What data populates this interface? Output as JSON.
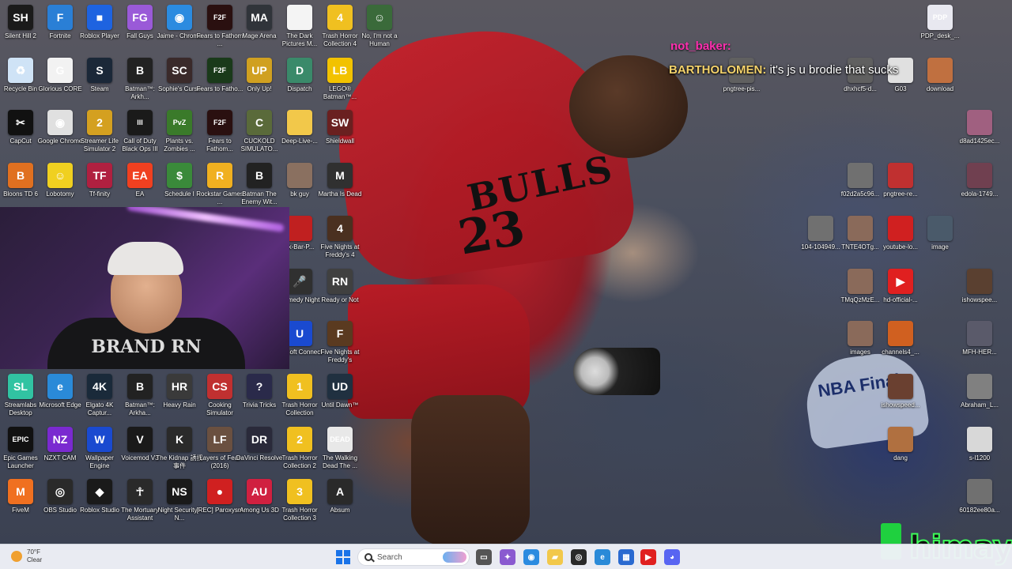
{
  "desktop": {
    "icons": [
      {
        "name": "silent-hill-2",
        "label": "Silent Hill 2",
        "icon": "silent-hill-icon",
        "color": "#1b1b1b",
        "glyph": "SH"
      },
      {
        "name": "fortnite",
        "label": "Fortnite",
        "icon": "fortnite-icon",
        "color": "#2a7fd6",
        "glyph": "F"
      },
      {
        "name": "roblox-player",
        "label": "Roblox Player",
        "icon": "roblox-icon",
        "color": "#1e63e0",
        "glyph": "■"
      },
      {
        "name": "fall-guys",
        "label": "Fall Guys",
        "icon": "fall-guys-icon",
        "color": "#9a5ad8",
        "glyph": "FG"
      },
      {
        "name": "jaime-chrome",
        "label": "Jaime - Chrome",
        "icon": "chrome-icon",
        "color": "#2b8be0",
        "glyph": "◉"
      },
      {
        "name": "fears-to-fathom-1",
        "label": "Fears to Fathom ...",
        "icon": "fears-to-fathom-icon",
        "color": "#2a1010",
        "glyph": "F2F"
      },
      {
        "name": "mage-arena",
        "label": "Mage Arena",
        "icon": "mage-arena-icon",
        "color": "#30343a",
        "glyph": "MA"
      },
      {
        "name": "dark-pictures",
        "label": "The Dark Pictures M...",
        "icon": "document-icon",
        "color": "#f4f4f4",
        "glyph": ""
      },
      {
        "name": "trash-horror-4",
        "label": "Trash Horror Collection 4",
        "icon": "trash-horror-icon",
        "color": "#f0c020",
        "glyph": "4"
      },
      {
        "name": "not-a-human",
        "label": "No, I'm not a Human",
        "icon": "not-a-human-icon",
        "color": "#3a6a3a",
        "glyph": "☺"
      },
      {
        "name": "recycle-bin",
        "label": "Recycle Bin",
        "icon": "recycle-bin-icon",
        "color": "#cfe3f6",
        "glyph": "♻"
      },
      {
        "name": "glorious-core",
        "label": "Glorious CORE",
        "icon": "glorious-core-icon",
        "color": "#f2f2f2",
        "glyph": "G"
      },
      {
        "name": "steam",
        "label": "Steam",
        "icon": "steam-icon",
        "color": "#1b2838",
        "glyph": "S"
      },
      {
        "name": "batman-arkham-1",
        "label": "Batman™: Arkh...",
        "icon": "batman-icon",
        "color": "#222",
        "glyph": "B"
      },
      {
        "name": "sophies-curse",
        "label": "Sophie's Curse",
        "icon": "sophies-curse-icon",
        "color": "#3a2a2a",
        "glyph": "SC"
      },
      {
        "name": "fears-to-fathom-2",
        "label": "Fears to Fatho...",
        "icon": "fears-to-fathom-icon",
        "color": "#1a3a1a",
        "glyph": "F2F"
      },
      {
        "name": "only-up",
        "label": "Only Up!",
        "icon": "only-up-icon",
        "color": "#d0a020",
        "glyph": "UP"
      },
      {
        "name": "dispatch",
        "label": "Dispatch",
        "icon": "dispatch-icon",
        "color": "#3a8a6a",
        "glyph": "D"
      },
      {
        "name": "lego-batman",
        "label": "LEGO® Batman™...",
        "icon": "lego-batman-icon",
        "color": "#f2c200",
        "glyph": "LB"
      },
      {
        "name": "capcut",
        "label": "CapCut",
        "icon": "capcut-icon",
        "color": "#111",
        "glyph": "✂"
      },
      {
        "name": "google-chrome",
        "label": "Google Chrome",
        "icon": "chrome-icon",
        "color": "#e0e0e0",
        "glyph": "◉"
      },
      {
        "name": "streamer-life-2",
        "label": "Streamer Life Simulator 2",
        "icon": "streamer-life-icon",
        "color": "#d4a020",
        "glyph": "2"
      },
      {
        "name": "cod-bo3",
        "label": "Call of Duty Black Ops III",
        "icon": "call-of-duty-icon",
        "color": "#1a1a1a",
        "glyph": "III"
      },
      {
        "name": "plants-vs-zombies",
        "label": "Plants vs. Zombies ...",
        "icon": "pvz-icon",
        "color": "#3a7a2a",
        "glyph": "PvZ"
      },
      {
        "name": "fears-to-fathom-3",
        "label": "Fears to Fathom...",
        "icon": "fears-to-fathom-icon",
        "color": "#2a1010",
        "glyph": "F2F"
      },
      {
        "name": "cuckold-simulator",
        "label": "CUCKOLD SIMULATO...",
        "icon": "game-icon",
        "color": "#5a6a3a",
        "glyph": "C"
      },
      {
        "name": "deep-live",
        "label": "Deep-Live-...",
        "icon": "folder-icon",
        "color": "#f2c84a",
        "glyph": ""
      },
      {
        "name": "shieldwall",
        "label": "Shieldwall",
        "icon": "shieldwall-icon",
        "color": "#6a2020",
        "glyph": "SW"
      },
      {
        "name": "bloons-td6",
        "label": "Bloons TD 6",
        "icon": "bloons-icon",
        "color": "#e07020",
        "glyph": "B"
      },
      {
        "name": "lobotomy",
        "label": "Lobotomy",
        "icon": "lobotomy-icon",
        "color": "#f0d020",
        "glyph": "☺"
      },
      {
        "name": "tf-infinity",
        "label": "Tf-finity",
        "icon": "tf-icon",
        "color": "#b02040",
        "glyph": "TF"
      },
      {
        "name": "ea",
        "label": "EA",
        "icon": "ea-icon",
        "color": "#f04020",
        "glyph": "EA"
      },
      {
        "name": "schedule-1",
        "label": "Schedule I",
        "icon": "schedule-icon",
        "color": "#3a8a3a",
        "glyph": "$"
      },
      {
        "name": "rockstar-games",
        "label": "Rockstar Games ...",
        "icon": "rockstar-icon",
        "color": "#f0b020",
        "glyph": "R"
      },
      {
        "name": "batman-enemy-within",
        "label": "Batman The Enemy Wit...",
        "icon": "batman-icon",
        "color": "#222",
        "glyph": "B"
      },
      {
        "name": "bk-guy",
        "label": "bk guy",
        "icon": "image-icon",
        "color": "#8a7060",
        "glyph": ""
      },
      {
        "name": "martha-is-dead",
        "label": "Martha Is Dead",
        "icon": "martha-icon",
        "color": "#303030",
        "glyph": "M"
      },
      {
        "name": "ck-bar",
        "label": "ck-Bar-P...",
        "icon": "file-icon",
        "color": "#c02020",
        "glyph": ""
      },
      {
        "name": "fnaf-4",
        "label": "Five Nights at Freddy's 4",
        "icon": "fnaf-icon",
        "color": "#4a3020",
        "glyph": "4"
      },
      {
        "name": "comedy-night",
        "label": "Comedy Night",
        "icon": "comedy-icon",
        "color": "#303030",
        "glyph": "🎤"
      },
      {
        "name": "ready-or-not",
        "label": "Ready or Not",
        "icon": "ready-or-not-icon",
        "color": "#404040",
        "glyph": "RN"
      },
      {
        "name": "ubisoft-connect",
        "label": "Ubisoft Connect",
        "icon": "ubisoft-icon",
        "color": "#1a4ad0",
        "glyph": "U"
      },
      {
        "name": "fnaf",
        "label": "Five Nights at Freddy's",
        "icon": "fnaf-icon",
        "color": "#5a3a20",
        "glyph": "F"
      },
      {
        "name": "streamlabs",
        "label": "Streamlabs Desktop",
        "icon": "streamlabs-icon",
        "color": "#31c3a2",
        "glyph": "SL"
      },
      {
        "name": "microsoft-edge",
        "label": "Microsoft Edge",
        "icon": "edge-icon",
        "color": "#2a8ad8",
        "glyph": "e"
      },
      {
        "name": "elgato-4k",
        "label": "Elgato 4K Captur...",
        "icon": "elgato-icon",
        "color": "#1a2a3a",
        "glyph": "4K"
      },
      {
        "name": "batman-arkham-2",
        "label": "Batman™: Arkha...",
        "icon": "batman-icon",
        "color": "#222",
        "glyph": "B"
      },
      {
        "name": "heavy-rain",
        "label": "Heavy Rain",
        "icon": "heavy-rain-icon",
        "color": "#3a3a3a",
        "glyph": "HR"
      },
      {
        "name": "cooking-simulator",
        "label": "Cooking Simulator",
        "icon": "cooking-icon",
        "color": "#c03030",
        "glyph": "CS"
      },
      {
        "name": "trivia-tricks",
        "label": "Trivia Tricks",
        "icon": "trivia-icon",
        "color": "#2a2a4a",
        "glyph": "?"
      },
      {
        "name": "trash-horror-1",
        "label": "Trash Horror Collection",
        "icon": "trash-horror-icon",
        "color": "#f0c020",
        "glyph": "1"
      },
      {
        "name": "until-dawn",
        "label": "Until Dawn™",
        "icon": "until-dawn-icon",
        "color": "#203040",
        "glyph": "UD"
      },
      {
        "name": "epic-games",
        "label": "Epic Games Launcher",
        "icon": "epic-games-icon",
        "color": "#111",
        "glyph": "EPIC"
      },
      {
        "name": "nzxt-cam",
        "label": "NZXT CAM",
        "icon": "nzxt-icon",
        "color": "#7a2ad0",
        "glyph": "NZ"
      },
      {
        "name": "wallpaper-engine",
        "label": "Wallpaper Engine",
        "icon": "wallpaper-engine-icon",
        "color": "#1a4ad0",
        "glyph": "W"
      },
      {
        "name": "voicemod",
        "label": "Voicemod V3",
        "icon": "voicemod-icon",
        "color": "#1a1a1a",
        "glyph": "V"
      },
      {
        "name": "the-kidnap",
        "label": "The Kidnap 誘拐事件",
        "icon": "kidnap-icon",
        "color": "#2a2a2a",
        "glyph": "K"
      },
      {
        "name": "layers-of-fear",
        "label": "Layers of Fear (2016)",
        "icon": "layers-of-fear-icon",
        "color": "#6a5040",
        "glyph": "LF"
      },
      {
        "name": "davinci-resolve",
        "label": "DaVinci Resolve",
        "icon": "davinci-icon",
        "color": "#2a2a3a",
        "glyph": "DR"
      },
      {
        "name": "trash-horror-2",
        "label": "Trash Horror Collection 2",
        "icon": "trash-horror-icon",
        "color": "#f0c020",
        "glyph": "2"
      },
      {
        "name": "walking-dead",
        "label": "The Walking Dead The ...",
        "icon": "walking-dead-icon",
        "color": "#e8e8e8",
        "glyph": "DEAD"
      },
      {
        "name": "fivem",
        "label": "FiveM",
        "icon": "fivem-icon",
        "color": "#f07020",
        "glyph": "M"
      },
      {
        "name": "obs-studio",
        "label": "OBS Studio",
        "icon": "obs-icon",
        "color": "#2a2a2a",
        "glyph": "◎"
      },
      {
        "name": "roblox-studio",
        "label": "Roblox Studio",
        "icon": "roblox-icon",
        "color": "#1a1a1a",
        "glyph": "◆"
      },
      {
        "name": "mortuary-assistant",
        "label": "The Mortuary Assistant",
        "icon": "mortuary-icon",
        "color": "#2a2a2a",
        "glyph": "☥"
      },
      {
        "name": "night-security",
        "label": "Night Security -N...",
        "icon": "night-security-icon",
        "color": "#1a1a1a",
        "glyph": "NS"
      },
      {
        "name": "rec-paroxysm",
        "label": "[REC] Paroxysm",
        "icon": "rec-icon",
        "color": "#d02020",
        "glyph": "●"
      },
      {
        "name": "among-us-3d",
        "label": "Among Us 3D",
        "icon": "among-us-icon",
        "color": "#d02040",
        "glyph": "AU"
      },
      {
        "name": "trash-horror-3",
        "label": "Trash Horror Collection 3",
        "icon": "trash-horror-icon",
        "color": "#f0c020",
        "glyph": "3"
      },
      {
        "name": "absum",
        "label": "Absum",
        "icon": "absum-icon",
        "color": "#2a2a2a",
        "glyph": "A"
      },
      {
        "name": "pdp-desk",
        "label": "PDP_desk_...",
        "icon": "pdp-icon",
        "color": "#e8e8f0",
        "glyph": "PDP"
      },
      {
        "name": "pngtree-1",
        "label": "pngtree-pis...",
        "icon": "image-icon",
        "color": "#606060",
        "glyph": ""
      },
      {
        "name": "dhxhcf",
        "label": "dhxhcf5-d...",
        "icon": "image-icon",
        "color": "#606060",
        "glyph": ""
      },
      {
        "name": "g03",
        "label": "G03",
        "icon": "image-icon",
        "color": "#e0e0e0",
        "glyph": ""
      },
      {
        "name": "download",
        "label": "download",
        "icon": "image-icon",
        "color": "#c07040",
        "glyph": ""
      },
      {
        "name": "dad142",
        "label": "d8ad1425ec...",
        "icon": "image-icon",
        "color": "#a06080",
        "glyph": ""
      },
      {
        "name": "f02d2",
        "label": "f02d2a5c96...",
        "icon": "image-icon",
        "color": "#707070",
        "glyph": ""
      },
      {
        "name": "pngtree-2",
        "label": "pngtree-re...",
        "icon": "image-icon",
        "color": "#c03030",
        "glyph": ""
      },
      {
        "name": "edola",
        "label": "edola-1749...",
        "icon": "image-icon",
        "color": "#704050",
        "glyph": ""
      },
      {
        "name": "104",
        "label": "104-104949...",
        "icon": "image-icon",
        "color": "#707070",
        "glyph": ""
      },
      {
        "name": "tnte4",
        "label": "TNTE4OTg...",
        "icon": "image-icon",
        "color": "#8a6a5a",
        "glyph": ""
      },
      {
        "name": "youtube-lo",
        "label": "youtube-lo...",
        "icon": "image-icon",
        "color": "#d02020",
        "glyph": ""
      },
      {
        "name": "image",
        "label": "image",
        "icon": "image-icon",
        "color": "#4a5a6a",
        "glyph": ""
      },
      {
        "name": "tmqzm",
        "label": "TMqQzMzE...",
        "icon": "image-icon",
        "color": "#8a6a5a",
        "glyph": ""
      },
      {
        "name": "hd-official",
        "label": "hd-official-...",
        "icon": "youtube-icon",
        "color": "#e02020",
        "glyph": "▶"
      },
      {
        "name": "ishowspee-1",
        "label": "ishowspee...",
        "icon": "image-icon",
        "color": "#5a4030",
        "glyph": ""
      },
      {
        "name": "images",
        "label": "images",
        "icon": "image-icon",
        "color": "#8a6a5a",
        "glyph": ""
      },
      {
        "name": "channels4",
        "label": "channels4_...",
        "icon": "image-icon",
        "color": "#d06020",
        "glyph": ""
      },
      {
        "name": "mfh-her",
        "label": "MFH-HER...",
        "icon": "image-icon",
        "color": "#5a5a6a",
        "glyph": ""
      },
      {
        "name": "ishowspeed",
        "label": "ishowspeed...",
        "icon": "image-icon",
        "color": "#6a4030",
        "glyph": ""
      },
      {
        "name": "abraham",
        "label": "Abraham_L...",
        "icon": "image-icon",
        "color": "#808080",
        "glyph": ""
      },
      {
        "name": "dang",
        "label": "dang",
        "icon": "image-icon",
        "color": "#b07040",
        "glyph": ""
      },
      {
        "name": "s-l1200",
        "label": "s-l1200",
        "icon": "image-icon",
        "color": "#d8d8d8",
        "glyph": ""
      },
      {
        "name": "60182",
        "label": "60182ee80a...",
        "icon": "image-icon",
        "color": "#707070",
        "glyph": ""
      }
    ]
  },
  "wallpaper": {
    "jersey_team": "BULLS",
    "jersey_number": "23",
    "shirt_text": "NBA Finals"
  },
  "webcam": {
    "shirt_text": "BRAND RN"
  },
  "chat": {
    "username": "not_baker:",
    "sender": "BARTHOLOMEN:",
    "message": "it's js u brodie that sucks"
  },
  "watermark": {
    "text": "himay"
  },
  "taskbar": {
    "weather_temp": "70°F",
    "weather_condition": "Clear",
    "search_placeholder": "Search",
    "accent": "#1a73e8",
    "apps": [
      {
        "name": "task-view",
        "icon": "task-view-icon",
        "color": "#555",
        "glyph": "▭"
      },
      {
        "name": "copilot",
        "icon": "copilot-icon",
        "color": "#8a5ad0",
        "glyph": "✦"
      },
      {
        "name": "chrome",
        "icon": "chrome-icon",
        "color": "#2b8be0",
        "glyph": "◉"
      },
      {
        "name": "file-explorer",
        "icon": "folder-icon",
        "color": "#f2c84a",
        "glyph": "▰"
      },
      {
        "name": "obs",
        "icon": "obs-icon",
        "color": "#2a2a2a",
        "glyph": "◎"
      },
      {
        "name": "edge",
        "icon": "edge-icon",
        "color": "#2a8ad8",
        "glyph": "e"
      },
      {
        "name": "microsoft-store",
        "icon": "store-icon",
        "color": "#2a6ad0",
        "glyph": "▦"
      },
      {
        "name": "youtube",
        "icon": "youtube-icon",
        "color": "#e02020",
        "glyph": "▶"
      },
      {
        "name": "discord",
        "icon": "discord-icon",
        "color": "#5865f2",
        "glyph": "◕"
      }
    ]
  }
}
